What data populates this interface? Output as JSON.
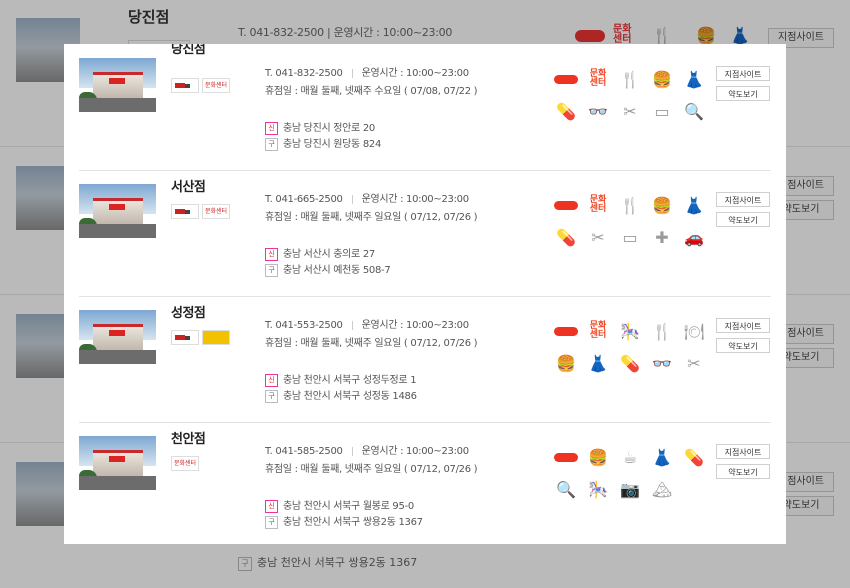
{
  "background": {
    "store_name": "당진점",
    "info": "T. 041-832-2500  |  운영시간 : 10:00~23:00",
    "address_old": "충남 천안시 서북구 쌍용2동 1367",
    "buttons": [
      "지점사이트",
      "약도보기",
      "지점사이트",
      "약도보기",
      "지점사이트",
      "약도보기",
      "지점사이트",
      "약도보기"
    ]
  },
  "stores": [
    {
      "name": "당진점",
      "tel": "T. 041-832-2500",
      "hours": "운영시간 : 10:00~23:00",
      "closed": "휴점일 : 매월 둘째, 넷째주 수요일 ( 07/08, 07/22 )",
      "address_new": "충남 당진시 정안로 20",
      "address_old": "충남 당진시 원당동 824",
      "logos": [
        "truck",
        "문화센터"
      ],
      "icons_row1": [
        "hi-mart-icon",
        "culture-center-icon",
        "restaurant-icon",
        "food-court-icon",
        "clothing-icon"
      ],
      "icons_row2": [
        "pharmacy-icon",
        "optician-icon",
        "hair-salon-icon",
        "bandage-icon",
        "laundry-icon"
      ],
      "site_btn": "지점사이트",
      "map_btn": "약도보기"
    },
    {
      "name": "서산점",
      "tel": "T. 041-665-2500",
      "hours": "운영시간 : 10:00~23:00",
      "closed": "휴점일 : 매월 둘째, 넷째주 일요일 ( 07/12, 07/26 )",
      "address_new": "충남 서산시 충의로 27",
      "address_old": "충남 서산시 예천동 508-7",
      "logos": [
        "truck",
        "문화센터"
      ],
      "icons_row1": [
        "hi-mart-icon",
        "culture-center-icon",
        "restaurant-icon",
        "food-court-icon",
        "clothing-icon"
      ],
      "icons_row2": [
        "pharmacy-icon",
        "hair-salon-icon",
        "bandage-icon",
        "clinic-icon",
        "car-wash-icon"
      ],
      "site_btn": "지점사이트",
      "map_btn": "약도보기"
    },
    {
      "name": "성정점",
      "tel": "T. 041-553-2500",
      "hours": "운영시간 : 10:00~23:00",
      "closed": "휴점일 : 매월 둘째, 넷째주 일요일 ( 07/12, 07/26 )",
      "address_new": "충남 천안시 서북구 성정두정로 1",
      "address_old": "충남 천안시 서북구 성정동 1486",
      "logos": [
        "truck",
        "yellow"
      ],
      "icons_row1": [
        "hi-mart-icon",
        "culture-center-icon",
        "kids-cafe-icon",
        "restaurant-icon",
        "dining-icon"
      ],
      "icons_row2": [
        "food-court-icon",
        "clothing-icon",
        "pharmacy-icon",
        "optician-icon",
        "hair-salon-icon"
      ],
      "site_btn": "지점사이트",
      "map_btn": "약도보기"
    },
    {
      "name": "천안점",
      "tel": "T. 041-585-2500",
      "hours": "운영시간 : 10:00~23:00",
      "closed": "휴점일 : 매월 둘째, 넷째주 일요일 ( 07/12, 07/26 )",
      "address_new": "충남 천안시 서북구 월봉로 95-0",
      "address_old": "충남 천안시 서북구 쌍용2동 1367",
      "logos": [
        "문화센터"
      ],
      "icons_row1": [
        "hi-mart-icon",
        "food-court-icon",
        "cafe-icon",
        "clothing-icon",
        "pharmacy-icon"
      ],
      "icons_row2": [
        "laundry-icon",
        "kids-cafe-icon",
        "photo-studio-icon",
        "travel-icon"
      ],
      "site_btn": "지점사이트",
      "map_btn": "약도보기"
    }
  ],
  "tags": {
    "new": "신",
    "old": "구"
  },
  "colors": {
    "accent": "#e33322",
    "overlay_dim": "rgba(0,0,0,0.27)"
  }
}
